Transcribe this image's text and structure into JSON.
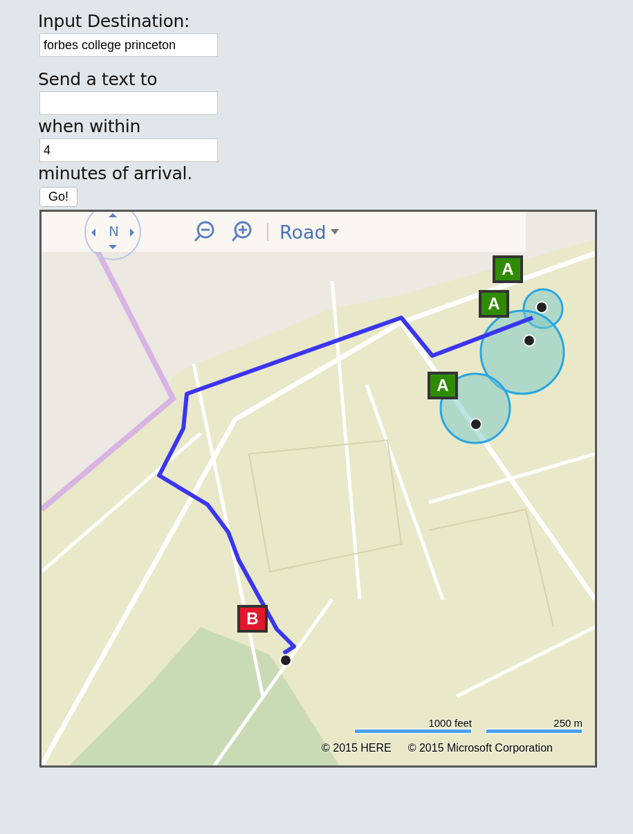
{
  "form": {
    "destination_label": "Input Destination:",
    "destination_value": "forbes college princeton",
    "phone_label": "Send a text to",
    "within_label": "when within",
    "minutes_value": "4",
    "arrival_label": "minutes of arrival.",
    "go_button": "Go!"
  },
  "map": {
    "compass": "N",
    "map_type": "Road",
    "pins": [
      {
        "label": "A",
        "color": "#2f8c00"
      },
      {
        "label": "A",
        "color": "#2f8c00"
      },
      {
        "label": "A",
        "color": "#2f8c00"
      },
      {
        "label": "B",
        "color": "#e3172b"
      }
    ],
    "scale": [
      "1000 feet",
      "250 m"
    ],
    "copyrights": [
      "© 2015 HERE",
      "© 2015 Microsoft Corporation"
    ]
  }
}
